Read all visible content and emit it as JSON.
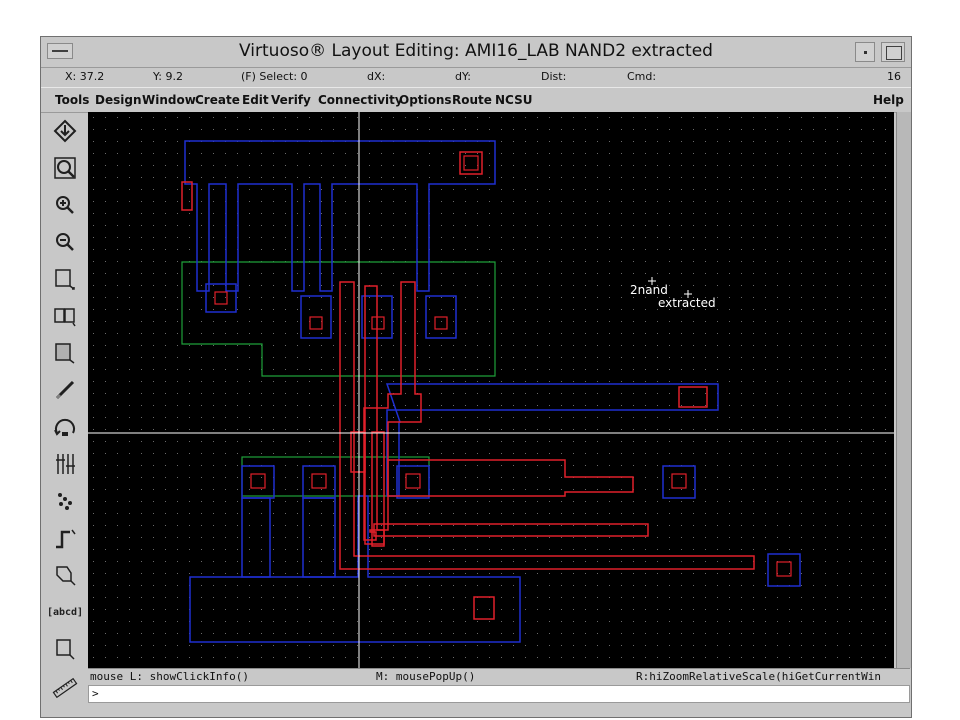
{
  "window": {
    "title": "Virtuoso® Layout Editing: AMI16_LAB NAND2 extracted"
  },
  "status": {
    "x": "X: 37.2",
    "y": "Y: 9.2",
    "select": "(F) Select: 0",
    "dx": "dX:",
    "dy": "dY:",
    "dist": "Dist:",
    "cmd": "Cmd:",
    "count": "16"
  },
  "menu": {
    "items": [
      "Tools",
      "Design",
      "Window",
      "Create",
      "Edit",
      "Verify",
      "Connectivity",
      "Options",
      "Route",
      "NCSU"
    ],
    "help": "Help"
  },
  "toolbar": {
    "icons": [
      "save-icon",
      "zoom-fit-icon",
      "zoom-in-icon",
      "zoom-out-icon",
      "stretch-icon",
      "copy-icon",
      "move-icon",
      "delete-icon",
      "undo-icon",
      "property-icon",
      "instance-icon",
      "path-icon",
      "polygon-icon",
      "label-icon",
      "rectangle-icon",
      "ruler-icon"
    ],
    "label_tool": "[abcd]"
  },
  "canvas": {
    "label_line1": "2nand",
    "label_line2": "extracted",
    "colors": {
      "background": "#000000",
      "grid": "#6a6a6a",
      "metal": "#1f2fd0",
      "poly": "#e0202a",
      "active": "#1fa03a",
      "crosshair": "#ffffff"
    }
  },
  "mouse_hints": {
    "left": "mouse L: showClickInfo()",
    "middle": "M: mousePopUp()",
    "right": "R:hiZoomRelativeScale(hiGetCurrentWin"
  },
  "prompt": ">"
}
